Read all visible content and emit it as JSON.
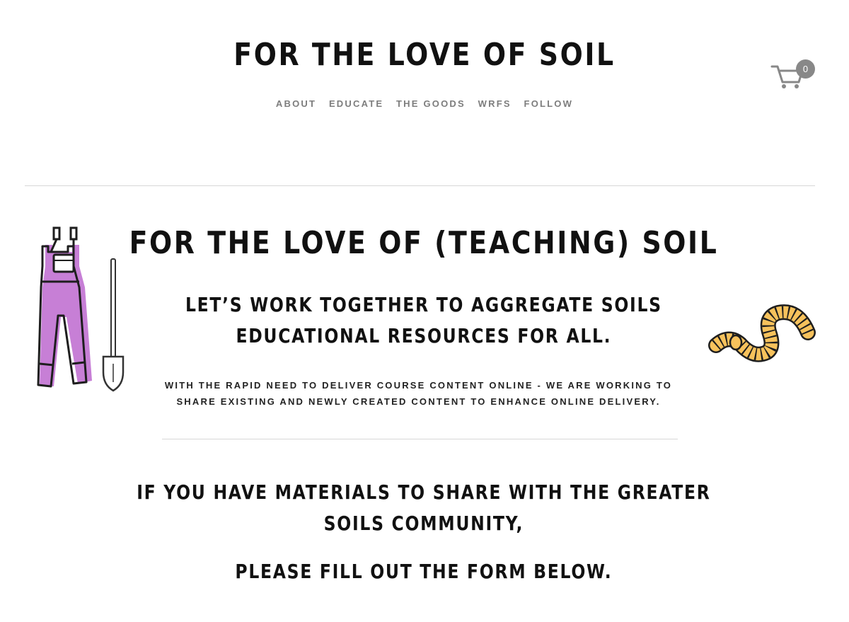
{
  "header": {
    "site_title": "FOR THE LOVE OF SOIL",
    "nav": [
      "ABOUT",
      "EDUCATE",
      "THE GOODS",
      "WRFS",
      "FOLLOW"
    ],
    "cart_count": "0"
  },
  "main": {
    "heading": "FOR THE LOVE OF (TEACHING) SOIL",
    "subheading_line1": "LET’S WORK TOGETHER TO AGGREGATE SOILS",
    "subheading_line2": "EDUCATIONAL RESOURCES FOR ALL.",
    "body_line1": "WITH THE RAPID NEED TO DELIVER COURSE CONTENT ONLINE - WE ARE WORKING TO",
    "body_line2": "SHARE EXISTING AND NEWLY CREATED CONTENT TO ENHANCE ONLINE DELIVERY.",
    "share_line1": "IF YOU HAVE MATERIALS TO SHARE WITH THE GREATER",
    "share_line2": "SOILS COMMUNITY,",
    "form_prompt": "PLEASE FILL OUT THE FORM BELOW."
  },
  "colors": {
    "overalls": "#c77fd6",
    "worm": "#f7c25c",
    "nav_text": "#7d7d7d",
    "badge": "#888888"
  },
  "icons": {
    "cart": "shopping-cart-icon",
    "overalls": "overalls-illustration",
    "shovel": "shovel-illustration",
    "worm": "worm-illustration"
  }
}
